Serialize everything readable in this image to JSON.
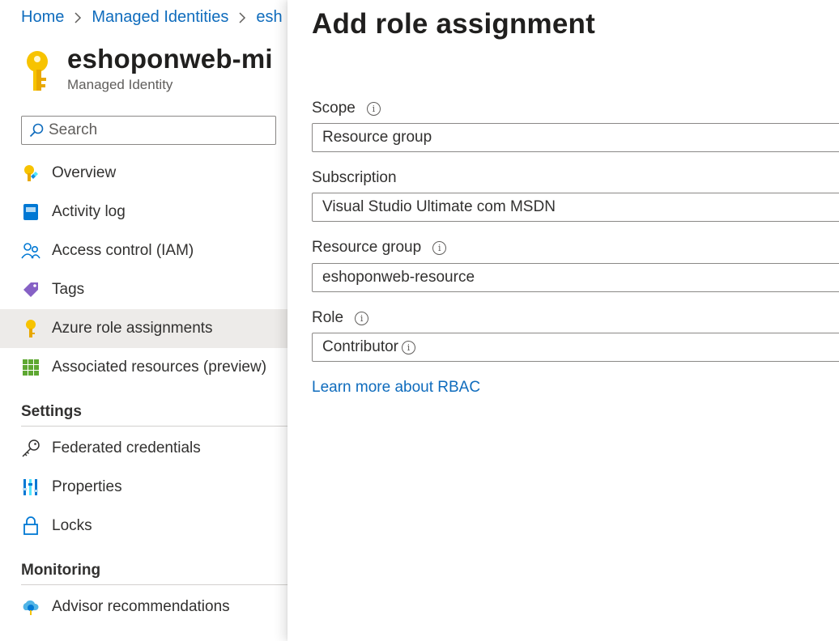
{
  "breadcrumb": {
    "home": "Home",
    "managed_identities": "Managed Identities",
    "current": "esh"
  },
  "resource": {
    "title": "eshoponweb-mi",
    "subtitle": "Managed Identity"
  },
  "search": {
    "placeholder": "Search"
  },
  "nav": {
    "items": [
      {
        "label": "Overview",
        "icon": "overview-icon"
      },
      {
        "label": "Activity log",
        "icon": "activity-log-icon"
      },
      {
        "label": "Access control (IAM)",
        "icon": "people-icon"
      },
      {
        "label": "Tags",
        "icon": "tag-icon"
      },
      {
        "label": "Azure role assignments",
        "icon": "key-icon",
        "active": true
      },
      {
        "label": "Associated resources (preview)",
        "icon": "grid-icon"
      }
    ],
    "settings_header": "Settings",
    "settings_items": [
      {
        "label": "Federated credentials",
        "icon": "key-outline-icon"
      },
      {
        "label": "Properties",
        "icon": "properties-icon"
      },
      {
        "label": "Locks",
        "icon": "lock-icon"
      }
    ],
    "monitoring_header": "Monitoring",
    "monitoring_items": [
      {
        "label": "Advisor recommendations",
        "icon": "advisor-cloud-icon"
      }
    ]
  },
  "panel": {
    "title": "Add role assignment",
    "scope": {
      "label": "Scope",
      "value": "Resource group"
    },
    "subscription": {
      "label": "Subscription",
      "value": "Visual Studio Ultimate com MSDN"
    },
    "resource_group": {
      "label": "Resource group",
      "value": "eshoponweb-resource"
    },
    "role": {
      "label": "Role",
      "value": "Contributor"
    },
    "learn_more": "Learn more about RBAC"
  },
  "colors": {
    "accent": "#0f6cbd",
    "active_item_bg": "#edebe9",
    "key_yellow": "#f7c300"
  }
}
